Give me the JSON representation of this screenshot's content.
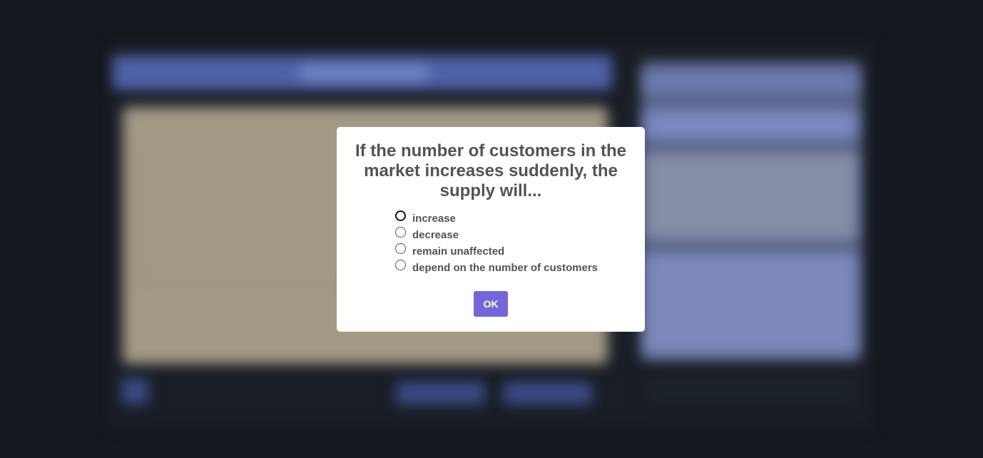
{
  "dialog": {
    "question": "If the number of customers in the market increases suddenly, the supply will...",
    "options": [
      {
        "label": "increase",
        "selected": false
      },
      {
        "label": "decrease",
        "selected": false
      },
      {
        "label": "remain unaffected",
        "selected": false
      },
      {
        "label": "depend on the number of customers",
        "selected": false
      }
    ],
    "ok_label": "OK"
  },
  "colors": {
    "ok_button": "#7367d8",
    "text": "#545454",
    "overlay": "#14171d"
  }
}
